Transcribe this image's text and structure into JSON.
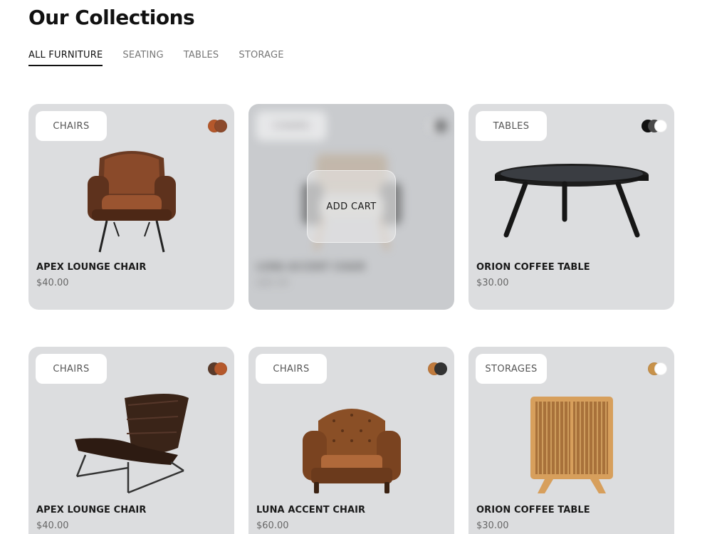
{
  "header": {
    "title": "Our Collections"
  },
  "tabs": [
    {
      "label": "ALL FURNITURE",
      "active": true
    },
    {
      "label": "SEATING",
      "active": false
    },
    {
      "label": "TABLES",
      "active": false
    },
    {
      "label": "STORAGE",
      "active": false
    }
  ],
  "products": [
    {
      "category": "CHAIRS",
      "name": "APEX LOUNGE CHAIR",
      "price": "$40.00",
      "swatches": [
        "#b5582b",
        "#8c4a2c"
      ],
      "art": "armchair-leather-icon"
    },
    {
      "category": "CHAIRS",
      "name": "LUNA ACCENT CHAIR",
      "price": "$60.00",
      "swatches": [
        "#efefef",
        "#333333"
      ],
      "art": "accent-chair-icon",
      "hovered": true,
      "hover_action": "ADD CART"
    },
    {
      "category": "TABLES",
      "name": "ORION COFFEE TABLE",
      "price": "$30.00",
      "swatches": [
        "#111111",
        "#4a4a4a",
        "#ffffff"
      ],
      "art": "coffee-table-icon"
    },
    {
      "category": "CHAIRS",
      "name": "APEX LOUNGE CHAIR",
      "price": "$40.00",
      "swatches": [
        "#5a3a2a",
        "#b5582b"
      ],
      "art": "lounge-chair-icon"
    },
    {
      "category": "CHAIRS",
      "name": "LUNA ACCENT CHAIR",
      "price": "$60.00",
      "swatches": [
        "#c07a3c",
        "#333333"
      ],
      "art": "chesterfield-chair-icon"
    },
    {
      "category": "STORAGES",
      "name": "ORION COFFEE TABLE",
      "price": "$30.00",
      "swatches": [
        "#c8924a",
        "#ffffff"
      ],
      "art": "cabinet-icon"
    }
  ]
}
